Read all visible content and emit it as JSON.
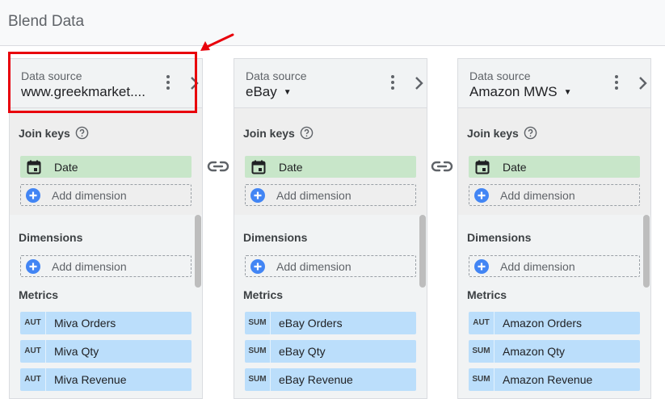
{
  "page": {
    "title": "Blend Data"
  },
  "panels": [
    {
      "label": "Data source",
      "name": "www.greekmarket....",
      "has_dropdown": false,
      "join_keys_label": "Join keys",
      "join_key": "Date",
      "add_dimension_label": "Add dimension",
      "dimensions_label": "Dimensions",
      "metrics_label": "Metrics",
      "metrics": [
        {
          "agg": "AUT",
          "name": "Miva Orders"
        },
        {
          "agg": "AUT",
          "name": "Miva Qty"
        },
        {
          "agg": "AUT",
          "name": "Miva Revenue"
        }
      ]
    },
    {
      "label": "Data source",
      "name": "eBay",
      "has_dropdown": true,
      "join_keys_label": "Join keys",
      "join_key": "Date",
      "add_dimension_label": "Add dimension",
      "dimensions_label": "Dimensions",
      "metrics_label": "Metrics",
      "metrics": [
        {
          "agg": "SUM",
          "name": "eBay Orders"
        },
        {
          "agg": "SUM",
          "name": "eBay Qty"
        },
        {
          "agg": "SUM",
          "name": "eBay Revenue"
        }
      ]
    },
    {
      "label": "Data source",
      "name": "Amazon MWS",
      "has_dropdown": true,
      "join_keys_label": "Join keys",
      "join_key": "Date",
      "add_dimension_label": "Add dimension",
      "dimensions_label": "Dimensions",
      "metrics_label": "Metrics",
      "metrics": [
        {
          "agg": "AUT",
          "name": "Amazon Orders"
        },
        {
          "agg": "SUM",
          "name": "Amazon Qty"
        },
        {
          "agg": "SUM",
          "name": "Amazon Revenue"
        }
      ]
    }
  ],
  "colors": {
    "join_key_chip": "#c8e6c9",
    "metric_chip": "#bbdefb",
    "add_icon": "#4285f4",
    "annotation": "#e8000b"
  },
  "icons": {
    "kebab": "more-vert-icon",
    "chevron": "chevron-right-icon",
    "help": "help-circle-icon",
    "calendar": "calendar-icon",
    "add": "add-circle-icon",
    "link": "link-icon"
  }
}
